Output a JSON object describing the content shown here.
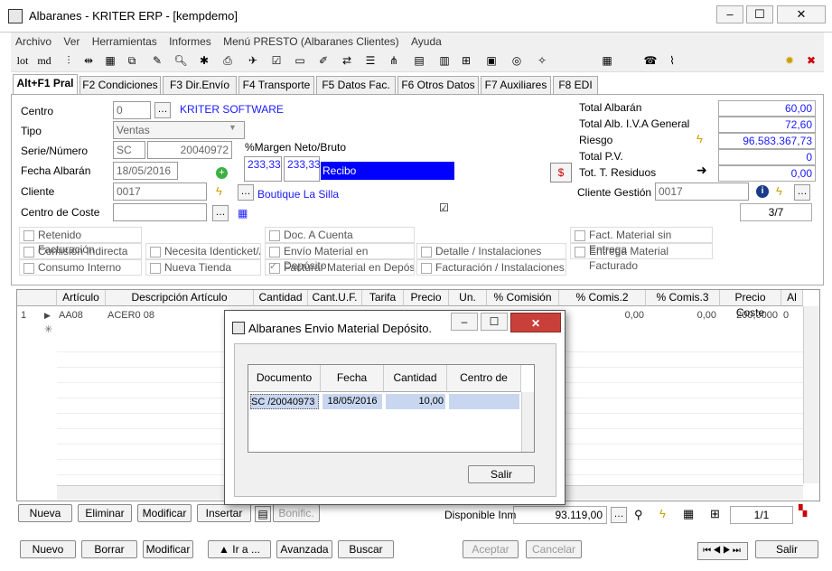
{
  "window": {
    "title": "Albaranes - KRITER ERP -  [kempdemo]"
  },
  "menu": [
    "Archivo",
    "Ver",
    "Herramientas",
    "Informes",
    "Menú PRESTO (Albaranes Clientes)",
    "Ayuda"
  ],
  "toolbar": {
    "lot": "lot",
    "md": "md"
  },
  "tabs": [
    "Alt+F1 Pral",
    "F2 Condiciones",
    "F3 Dir.Envío",
    "F4 Transporte",
    "F5 Datos Fac.",
    "F6 Otros Datos",
    "F7 Auxiliares",
    "F8 EDI"
  ],
  "form": {
    "centro_label": "Centro",
    "centro_value": "0",
    "centro_name": "KRITER SOFTWARE",
    "tipo_label": "Tipo",
    "tipo_value": "Ventas",
    "serie_label": "Serie/Número",
    "serie_value": "SC",
    "numero_value": "20040972",
    "fecha_label": "Fecha Albarán",
    "fecha_value": "18/05/2016",
    "cliente_label": "Cliente",
    "cliente_value": "0017",
    "cliente_name": "Boutique La Silla",
    "centro_coste_label": "Centro de Coste",
    "margen_label": "%Margen Neto/Bruto",
    "margen_neto": "233,33",
    "margen_bruto": "233,33",
    "recibo": "Recibo",
    "total_albaran_label": "Total Albarán",
    "total_albaran": "60,00",
    "total_iva_label": "Total Alb. I.V.A General",
    "total_iva": "72,60",
    "riesgo_label": "Riesgo",
    "riesgo": "96.583.367,73",
    "total_pv_label": "Total P.V.",
    "total_pv": "0",
    "tot_residuos_label": "Tot. T. Residuos",
    "tot_residuos": "0,00",
    "cliente_gestion_label": "Cliente Gestión",
    "cliente_gestion": "0017",
    "page": "3/7"
  },
  "checks": [
    {
      "label": "Retenido Facturación",
      "checked": false
    },
    {
      "label": "Doc. A Cuenta",
      "checked": false
    },
    {
      "label": "Fact. Material sin Entrega",
      "checked": false
    },
    {
      "label": "Comisión Indirecta",
      "checked": false
    },
    {
      "label": "Necesita Identicket/A",
      "checked": false
    },
    {
      "label": "Envío Material en Depósito",
      "checked": false
    },
    {
      "label": "Detalle / Instalaciones",
      "checked": false
    },
    {
      "label": "Entrega Material Facturado",
      "checked": false
    },
    {
      "label": "Consumo Interno",
      "checked": false
    },
    {
      "label": "Nueva Tienda",
      "checked": false
    },
    {
      "label": "Facturar Material en Depósito",
      "checked": true
    },
    {
      "label": "Facturación / Instalaciones",
      "checked": false
    }
  ],
  "grid": {
    "headers": [
      "Artículo",
      "Descripción Artículo",
      "Cantidad",
      "Cant.U.F.",
      "Tarifa",
      "Precio",
      "Un.",
      "% Comisión",
      "% Comis.2",
      "% Comis.3",
      "Precio Coste",
      "Al"
    ],
    "row": {
      "num": "1",
      "articulo": "AA08",
      "descripcion": "ACER0 08",
      "comis2": "0,00",
      "comis3": "0,00",
      "precio_coste": "200,0000",
      "al": "0"
    }
  },
  "buttons1": {
    "nueva": "Nueva",
    "eliminar": "Eliminar",
    "modificar": "Modificar",
    "insertar": "Insertar",
    "bonific": "Bonific.",
    "disponible_label": "Disponible Inm",
    "disponible": "93.119,00",
    "page": "1/1"
  },
  "buttons2": {
    "nuevo": "Nuevo",
    "borrar": "Borrar",
    "modificar": "Modificar",
    "ira": "Ir a ...",
    "avanzada": "Avanzada",
    "buscar": "Buscar",
    "aceptar": "Aceptar",
    "cancelar": "Cancelar",
    "salir": "Salir"
  },
  "dialog": {
    "title": "Albaranes Envio Material Depósito.",
    "headers": [
      "Documento",
      "Fecha",
      "Cantidad",
      "Centro de Coste"
    ],
    "row": {
      "documento": "SC /20040973",
      "fecha": "18/05/2016",
      "cantidad": "10,00",
      "centro": ""
    },
    "salir": "Salir"
  },
  "colors": {
    "accent": "#1a1aff",
    "recibo_bg": "#0000ff"
  }
}
